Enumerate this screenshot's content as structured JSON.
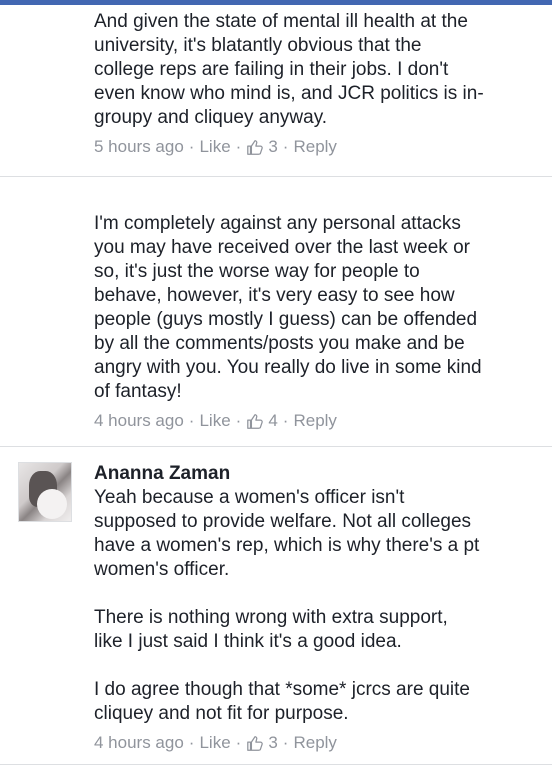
{
  "comments": [
    {
      "author": "",
      "text": "And given the state of mental ill health at the\nuniversity, it's blatantly obvious that the\ncollege reps are failing in their jobs. I don't\neven know who mind is, and JCR politics is in-\ngroupy and cliquey anyway.",
      "time": "5 hours ago",
      "like_label": "Like",
      "like_count": "3",
      "reply_label": "Reply"
    },
    {
      "author": "",
      "text": "I'm completely against any personal attacks\nyou may have received over the last week or\nso, it's just the worse way for people to\nbehave, however,  it's very easy to see how\npeople (guys mostly I guess) can be offended\nby all the comments/posts you make and be\nangry with you. You really do live in some kind\nof fantasy!",
      "time": "4 hours ago",
      "like_label": "Like",
      "like_count": "4",
      "reply_label": "Reply"
    },
    {
      "author": "Ananna Zaman",
      "text": "Yeah because a women's officer isn't\nsupposed to provide welfare. Not all colleges\nhave a women's rep, which is why there's a pt\nwomen's officer.\n\nThere is nothing wrong with extra support,\nlike I just said I think it's a good idea.\n\nI do agree though that *some* jcrcs are quite\ncliquey and not fit for purpose.",
      "time": "4 hours ago",
      "like_label": "Like",
      "like_count": "3",
      "reply_label": "Reply"
    }
  ],
  "separator": "·",
  "icons": {
    "like": "thumbs-up-icon",
    "avatar": "profile-photo"
  },
  "colors": {
    "text": "#1d2129",
    "meta": "#90949c",
    "divider": "#dddfe2",
    "accent": "#4267b2"
  }
}
